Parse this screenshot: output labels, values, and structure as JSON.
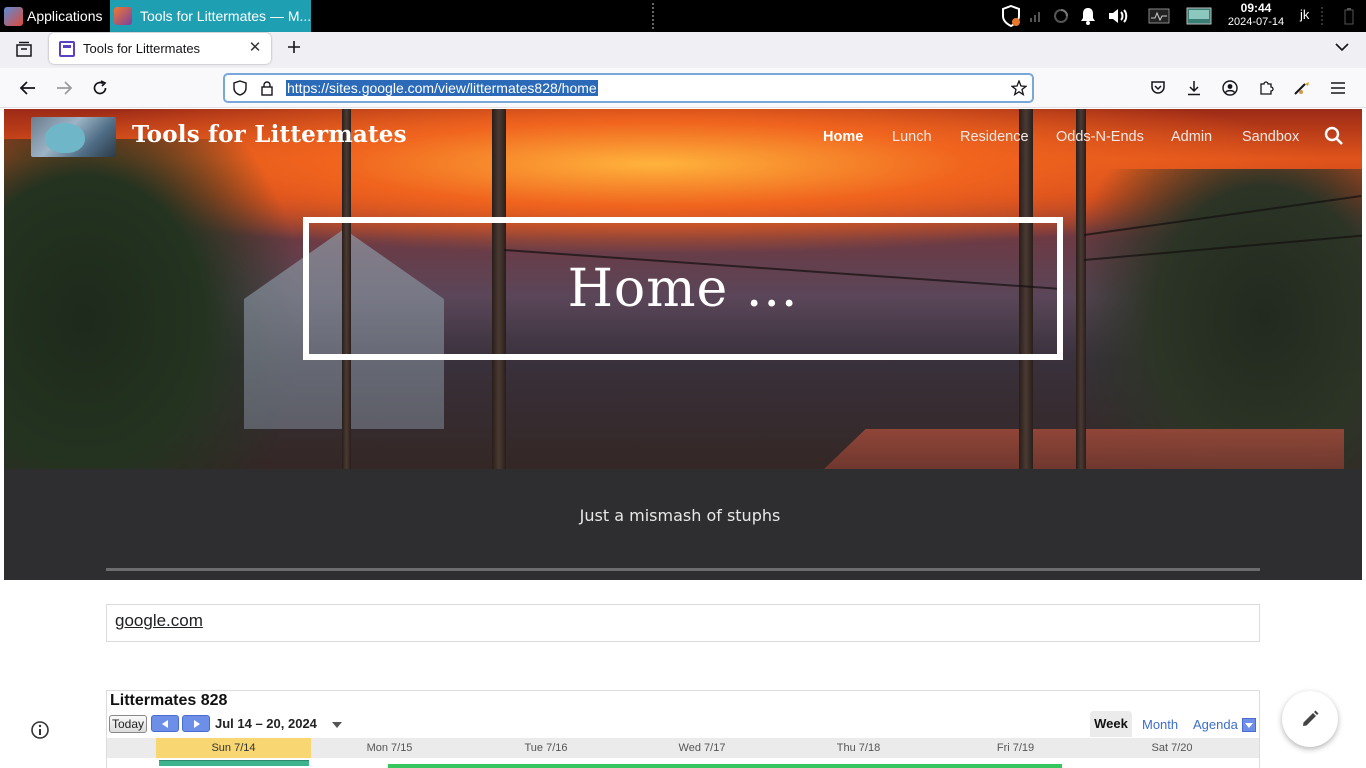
{
  "taskbar": {
    "applications_label": "Applications",
    "active_task_label": "Tools for Littermates — M...",
    "clock_time": "09:44",
    "clock_date": "2024-07-14",
    "user": "jk"
  },
  "browser": {
    "tab_title": "Tools for Littermates",
    "url": "https://sites.google.com/view/littermates828/home"
  },
  "site": {
    "title": "Tools for Littermates",
    "nav": [
      "Home",
      "Lunch",
      "Residence",
      "Odds-N-Ends",
      "Admin",
      "Sandbox"
    ],
    "active_nav": "Home",
    "page_heading": "Home ...",
    "tagline": "Just a mismash of stuphs",
    "link_text": "google.com"
  },
  "calendar": {
    "title": "Littermates 828",
    "today_label": "Today",
    "date_range": "Jul 14 – 20, 2024",
    "views": [
      "Week",
      "Month",
      "Agenda"
    ],
    "selected_view": "Week",
    "days": [
      "Sun 7/14",
      "Mon 7/15",
      "Tue 7/16",
      "Wed 7/17",
      "Thu 7/18",
      "Fri 7/19",
      "Sat 7/20"
    ],
    "today_day": "Sun 7/14"
  },
  "colors": {
    "taskbar_bg": "#000000",
    "active_task_bg": "#1f9fb2",
    "url_selection": "#2a6ab8",
    "tagline_band": "#2e2e30",
    "calendar_today": "#f8d773",
    "calendar_nav": "#6d8fe8"
  }
}
